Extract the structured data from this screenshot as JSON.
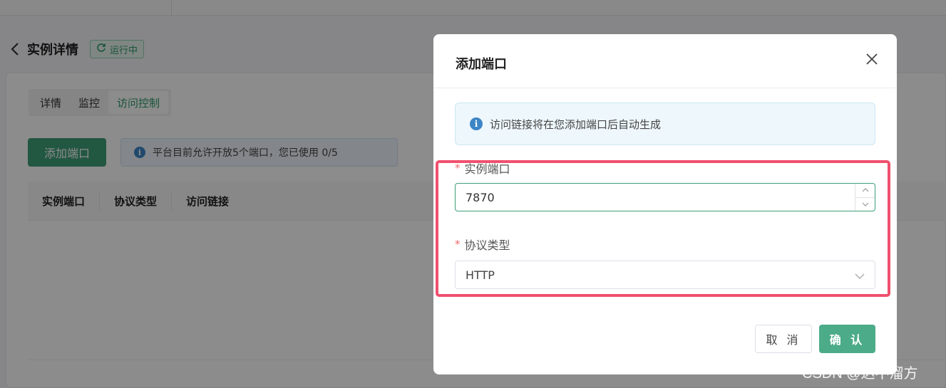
{
  "page": {
    "title": "实例详情",
    "status": "运行中",
    "tabs": [
      {
        "label": "详情"
      },
      {
        "label": "监控"
      },
      {
        "label": "访问控制"
      }
    ],
    "add_port_button": "添加端口",
    "port_notice": "平台目前允许开放5个端口，您已使用 0/5",
    "table_headers": [
      "实例端口",
      "协议类型",
      "访问链接"
    ]
  },
  "dialog": {
    "title": "添加端口",
    "info": "访问链接将在您添加端口后自动生成",
    "port_label": "实例端口",
    "port_value": "7870",
    "protocol_label": "协议类型",
    "protocol_value": "HTTP",
    "cancel_label": "取 消",
    "confirm_label": "确 认"
  },
  "watermark": "CSDN @达不溜方",
  "colors": {
    "accent": "#3f9e77",
    "highlight": "#f0506e",
    "info": "#3d85c6"
  }
}
